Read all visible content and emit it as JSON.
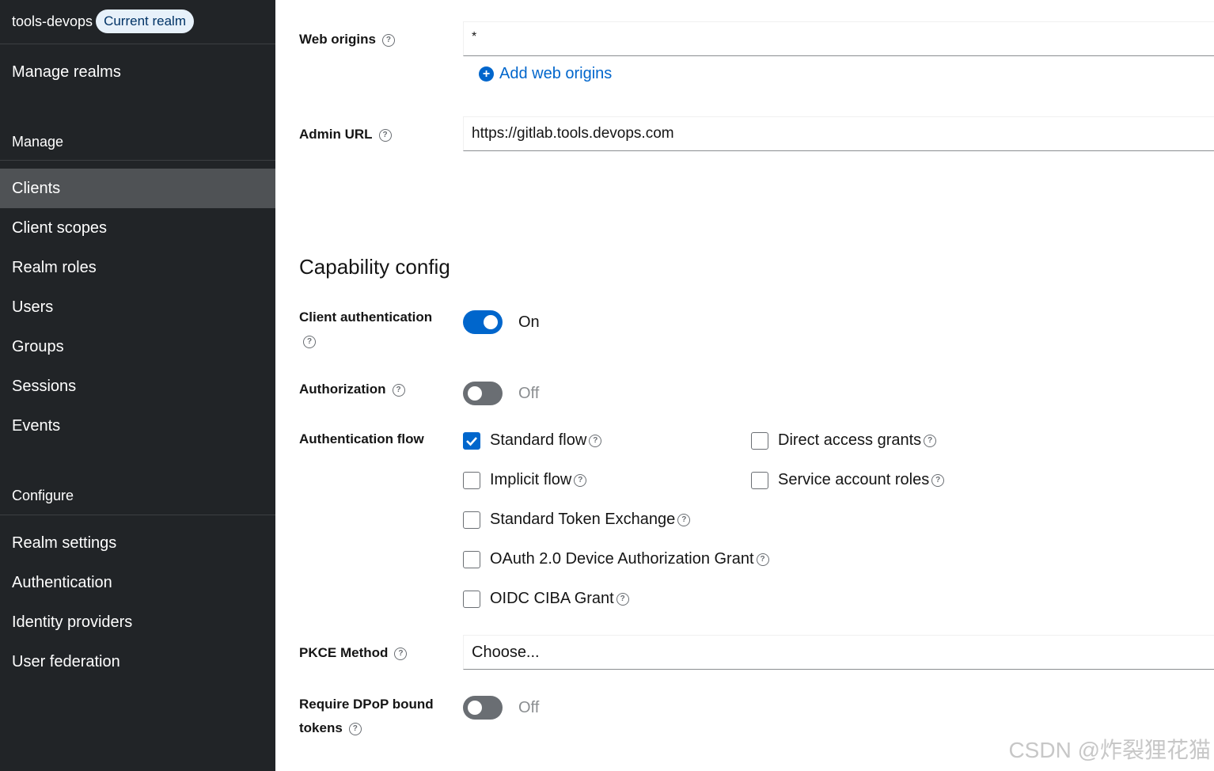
{
  "sidebar": {
    "realm_name": "tools-devops",
    "realm_badge": "Current realm",
    "manage_realms": "Manage realms",
    "manage_title": "Manage",
    "manage_items": [
      "Clients",
      "Client scopes",
      "Realm roles",
      "Users",
      "Groups",
      "Sessions",
      "Events"
    ],
    "active_item": "Clients",
    "configure_title": "Configure",
    "configure_items": [
      "Realm settings",
      "Authentication",
      "Identity providers",
      "User federation"
    ]
  },
  "access": {
    "web_origins_label": "Web origins",
    "web_origins_value": "*",
    "add_web_origins": "Add web origins",
    "admin_url_label": "Admin URL",
    "admin_url_value": "https://gitlab.tools.devops.com"
  },
  "capability": {
    "heading": "Capability config",
    "client_auth_label": "Client authentication",
    "client_auth_state": "On",
    "authorization_label": "Authorization",
    "authorization_state": "Off",
    "auth_flow_label": "Authentication flow",
    "flows": {
      "standard_flow": {
        "label": "Standard flow",
        "checked": true
      },
      "direct_access_grants": {
        "label": "Direct access grants",
        "checked": false
      },
      "implicit_flow": {
        "label": "Implicit flow",
        "checked": false
      },
      "service_account_roles": {
        "label": "Service account roles",
        "checked": false
      },
      "standard_token_exchange": {
        "label": "Standard Token Exchange",
        "checked": false
      },
      "device_grant": {
        "label": "OAuth 2.0 Device Authorization Grant",
        "checked": false
      },
      "ciba_grant": {
        "label": "OIDC CIBA Grant",
        "checked": false
      }
    },
    "pkce_label": "PKCE Method",
    "pkce_value": "Choose...",
    "dpop_label_line1": "Require DPoP bound",
    "dpop_label_line2": "tokens",
    "dpop_state": "Off"
  },
  "watermark": "CSDN @炸裂狸花猫",
  "colors": {
    "sidebar_bg": "#212427",
    "active_nav": "#4f5255",
    "primary": "#0066cc"
  }
}
